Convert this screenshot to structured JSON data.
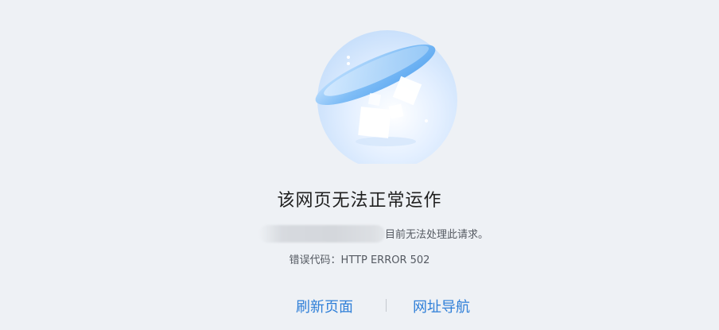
{
  "error_page": {
    "title": "该网页无法正常运作",
    "description": "目前无法处理此请求。",
    "error_code": "错误代码：HTTP ERROR 502"
  },
  "actions": {
    "refresh_label": "刷新页面",
    "nav_label": "网址导航"
  },
  "colors": {
    "background": "#eef1f5",
    "link": "#2f7fd8",
    "title": "#1f1f1f",
    "text": "#555a62"
  }
}
